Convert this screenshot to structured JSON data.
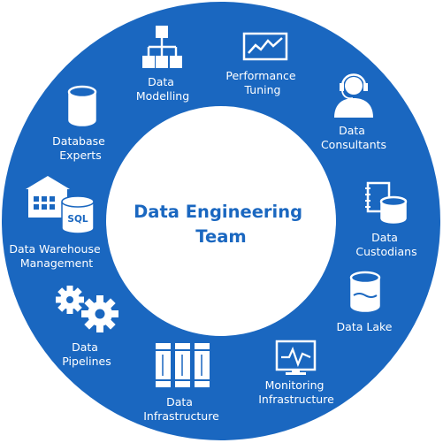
{
  "colors": {
    "ring": "#1a67c0",
    "center": "#ffffff",
    "title": "#1a67c0",
    "icon": "#ffffff"
  },
  "center": {
    "line1": "Data Engineering",
    "line2": "Team"
  },
  "segments": [
    {
      "line1": "Data",
      "line2": "Modelling",
      "icon": "hierarchy-icon"
    },
    {
      "line1": "Performance",
      "line2": "Tuning",
      "icon": "line-chart-icon"
    },
    {
      "line1": "Data",
      "line2": "Consultants",
      "icon": "headset-person-icon"
    },
    {
      "line1": "Data",
      "line2": "Custodians",
      "icon": "notebook-database-icon"
    },
    {
      "line1": "Data Lake",
      "icon": "database-cylinder-icon"
    },
    {
      "line1": "Monitoring",
      "line2": "Infrastructure",
      "icon": "monitor-pulse-icon"
    },
    {
      "line1": "Data",
      "line2": "Infrastructure",
      "icon": "server-racks-icon"
    },
    {
      "line1": "Data",
      "line2": "Pipelines",
      "icon": "gears-icon"
    },
    {
      "line1": "Data Warehouse",
      "line2": "Management",
      "icon": "warehouse-sql-icon",
      "badge": "SQL"
    },
    {
      "line1": "Database",
      "line2": "Experts",
      "icon": "database-cylinder-icon"
    }
  ]
}
